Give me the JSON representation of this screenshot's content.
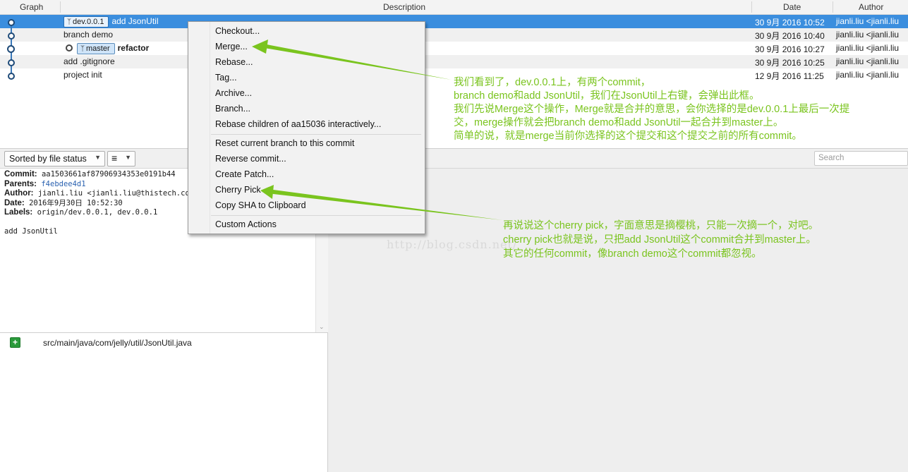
{
  "table": {
    "columns": {
      "graph": "Graph",
      "description": "Description",
      "date": "Date",
      "author": "Author"
    },
    "commits": [
      {
        "tag": "dev.0.0.1",
        "description": "add JsonUtil",
        "date": "30 9月 2016 10:52",
        "author": "jianli.liu <jianli.liu"
      },
      {
        "description": "branch demo",
        "date": "30 9月 2016 10:40",
        "author": "jianli.liu <jianli.liu"
      },
      {
        "tag": "master",
        "description": "refactor",
        "date": "30 9月 2016 10:27",
        "author": "jianli.liu <jianli.liu"
      },
      {
        "description": "add .gitignore",
        "date": "30 9月 2016 10:25",
        "author": "jianli.liu <jianli.liu"
      },
      {
        "description": "project init",
        "date": "12 9月 2016 11:25",
        "author": "jianli.liu <jianli.liu"
      }
    ]
  },
  "toolbar": {
    "sort_label": "Sorted by file status",
    "view_icon": "list-icon",
    "search_placeholder": "Search"
  },
  "details": {
    "commit_key": "Commit:",
    "commit_val": "aa1503661af87906934353e0191b44",
    "parents_key": "Parents:",
    "parents_val": "f4ebdee4d1",
    "author_key": "Author:",
    "author_val": "jianli.liu <jianli.liu@thistech.com>",
    "date_key": "Date:",
    "date_val": "2016年9月30日 10:52:30",
    "labels_key": "Labels:",
    "labels_val": "origin/dev.0.0.1, dev.0.0.1",
    "message": "add JsonUtil"
  },
  "files": [
    {
      "status_icon": "file-added-icon",
      "path": "src/main/java/com/jelly/util/JsonUtil.java"
    }
  ],
  "watermark": "http://blog.csdn.net/",
  "context_menu": {
    "checkout": "Checkout...",
    "merge": "Merge...",
    "rebase": "Rebase...",
    "tag": "Tag...",
    "archive": "Archive...",
    "branch": "Branch...",
    "rebase_children": "Rebase children of aa15036 interactively...",
    "reset": "Reset current branch to this commit",
    "reverse": "Reverse commit...",
    "create_patch": "Create Patch...",
    "cherry_pick": "Cherry Pick",
    "copy_sha": "Copy SHA to Clipboard",
    "custom_actions": "Custom Actions"
  },
  "annotations": {
    "merge_note": [
      "我们看到了，dev.0.0.1上，有两个commit，",
      "branch demo和add JsonUtil，我们在JsonUtil上右键，会弹出此框。",
      "我们先说Merge这个操作，Merge就是合并的意思，会你选择的是dev.0.0.1上最后一次提",
      "交，merge操作就会把branch demo和add JsonUtil一起合并到master上。",
      "简单的说，就是merge当前你选择的这个提交和这个提交之前的所有commit。"
    ],
    "cherry_note": [
      "再说说这个cherry pick，字面意思是摘樱桃，只能一次摘一个，对吧。",
      "cherry pick也就是说，只把add JsonUtil这个commit合并到master上。",
      "其它的任何commit，像branch demo这个commit都忽视。"
    ]
  },
  "colors": {
    "selection": "#3b8ede",
    "annotation": "#7ac41e",
    "graph": "#3b79b9"
  }
}
